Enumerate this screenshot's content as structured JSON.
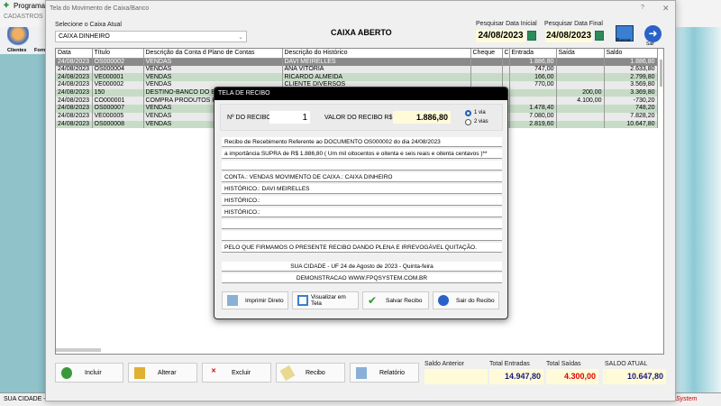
{
  "app": {
    "title": "Programa",
    "menu": "CADASTROS",
    "tools": [
      "Clientes",
      "Forn"
    ],
    "status_left": "SUA CIDADE -",
    "status_right": "System"
  },
  "window": {
    "title": "Tela do Movimento de Caixa/Banco",
    "help": "?",
    "close": "✕",
    "cash_label": "Selecione o Caixa Atual",
    "cash_value": "CAIXA DINHEIRO",
    "status": "CAIXA ABERTO",
    "date_start_label": "Pesquisar Data Inicial",
    "date_start": "24/08/2023",
    "date_end_label": "Pesquisar Data Final",
    "date_end": "24/08/2023",
    "search_label": "Buscar",
    "exit_label": "Sair"
  },
  "table": {
    "columns": [
      "Data",
      "Título",
      "Descrição da Conta d Plano de Contas",
      "Descrição do Histórico",
      "Cheque",
      "C",
      "Entrada",
      "Saída",
      "Saldo"
    ],
    "rows": [
      [
        "24/08/2023",
        "OS000002",
        "VENDAS",
        "DAVI MEIRELLES",
        "",
        "",
        "1.886,80",
        "",
        "1.886,80"
      ],
      [
        "24/08/2023",
        "OS000004",
        "VENDAS",
        "ANA VITÓRIA",
        "",
        "",
        "747,00",
        "",
        "2.633,80"
      ],
      [
        "24/08/2023",
        "VE000001",
        "VENDAS",
        "RICARDO ALMEIDA",
        "",
        "",
        "166,00",
        "",
        "2.799,80"
      ],
      [
        "24/08/2023",
        "VE000002",
        "VENDAS",
        "CLIENTE DIVERSOS",
        "",
        "",
        "770,00",
        "",
        "3.569,80"
      ],
      [
        "24/08/2023",
        "150",
        "DESTINO-BANCO DO BRASIL",
        "",
        "",
        "",
        "",
        "200,00",
        "3.369,80"
      ],
      [
        "24/08/2023",
        "CO000001",
        "COMPRA PRODUTOS PRA",
        "",
        "",
        "",
        "",
        "4.100,00",
        "-730,20"
      ],
      [
        "24/08/2023",
        "OS000007",
        "VENDAS",
        "",
        "",
        "",
        "1.478,40",
        "",
        "748,20"
      ],
      [
        "24/08/2023",
        "VE000005",
        "VENDAS",
        "",
        "",
        "",
        "7.080,00",
        "",
        "7.828,20"
      ],
      [
        "24/08/2023",
        "OS000008",
        "VENDAS",
        "",
        "",
        "",
        "2.819,60",
        "",
        "10.647,80"
      ]
    ]
  },
  "buttons": {
    "include": "Incluir",
    "edit": "Alterar",
    "delete": "Excluir",
    "receipt": "Recibo",
    "report": "Relatório"
  },
  "totals": {
    "prev_label": "Saldo Anterior",
    "prev": "",
    "in_label": "Total Entradas",
    "in": "14.947,80",
    "out_label": "Total Saídas",
    "out": "4.300,00",
    "cur_label": "SALDO ATUAL",
    "cur": "10.647,80"
  },
  "dialog": {
    "title": "TELA DE RECIBO",
    "num_label": "Nº DO RECIBO",
    "num": "1",
    "value_label": "VALOR DO RECIBO R$",
    "value": "1.886,80",
    "via1": "1 via",
    "via2": "2 vias",
    "lines": [
      "Recibo de Recebimento Referente ao DOCUMENTO OS000002    do dia 24/08/2023",
      "a importância SUPRA de R$    1.886,80 ( Um mil oitocentos e oitenta e seis reais e oitenta  centavos )**",
      "",
      "CONTA.: VENDAS               MOVIMENTO DE CAIXA.: CAIXA DINHEIRO",
      "HISTÓRICO.: DAVI MEIRELLES",
      "HISTÓRICO.:",
      "HISTÓRICO.:",
      "",
      "",
      "PELO QUE FIRMAMOS O PRESENTE RECIBO DANDO PLENA E IRREVOGÁVEL QUITAÇÃO."
    ],
    "city": "SUA CIDADE - UF 24 de Agosto de 2023 - Quinta-feira",
    "company": "DEMONSTRACAO WWW.FPQSYSTEM.COM.BR",
    "btn_print": "Imprimir Direto",
    "btn_view": "Visualizar em Tela",
    "btn_save": "Salvar Recibo",
    "btn_exit": "Sair do Recibo"
  }
}
